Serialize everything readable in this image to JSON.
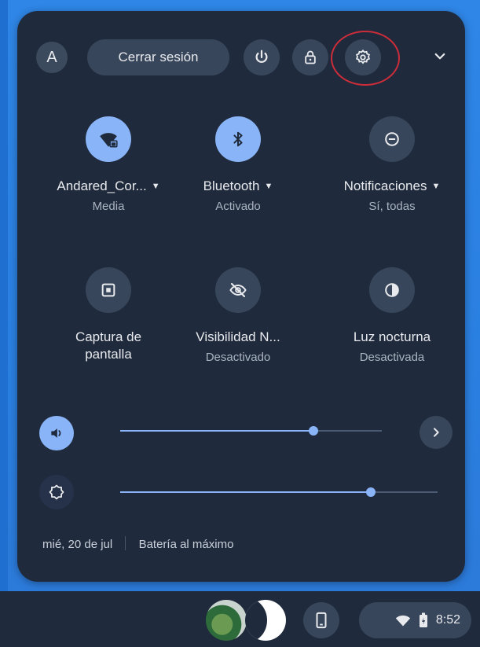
{
  "header": {
    "avatar_initial": "A",
    "signout_label": "Cerrar sesión"
  },
  "pods": [
    {
      "label": "Andared_Cor...",
      "sub": "Media",
      "icon": "wifi-lock-icon",
      "active": true,
      "has_caret": true
    },
    {
      "label": "Bluetooth",
      "sub": "Activado",
      "icon": "bluetooth-icon",
      "active": true,
      "has_caret": true
    },
    {
      "label": "Notificaciones",
      "sub": "Sí, todas",
      "icon": "do-not-disturb-icon",
      "active": false,
      "has_caret": true
    },
    {
      "label_line1": "Captura de",
      "label_line2": "pantalla",
      "icon": "screen-capture-icon",
      "active": false
    },
    {
      "label": "Visibilidad N...",
      "sub": "Desactivado",
      "icon": "visibility-off-icon",
      "active": false
    },
    {
      "label": "Luz nocturna",
      "sub": "Desactivada",
      "icon": "night-light-icon",
      "active": false
    }
  ],
  "sliders": {
    "volume": {
      "level": 0.74,
      "icon": "volume-icon"
    },
    "brightness": {
      "level": 0.79,
      "icon": "brightness-icon"
    }
  },
  "footer": {
    "date": "mié, 20 de jul",
    "battery": "Batería al máximo"
  },
  "shelf": {
    "time": "8:52"
  },
  "colors": {
    "panel": "#1f2a3c",
    "accent": "#8ab4f8",
    "button": "#38465b",
    "annotation": "#cc2d3a"
  }
}
